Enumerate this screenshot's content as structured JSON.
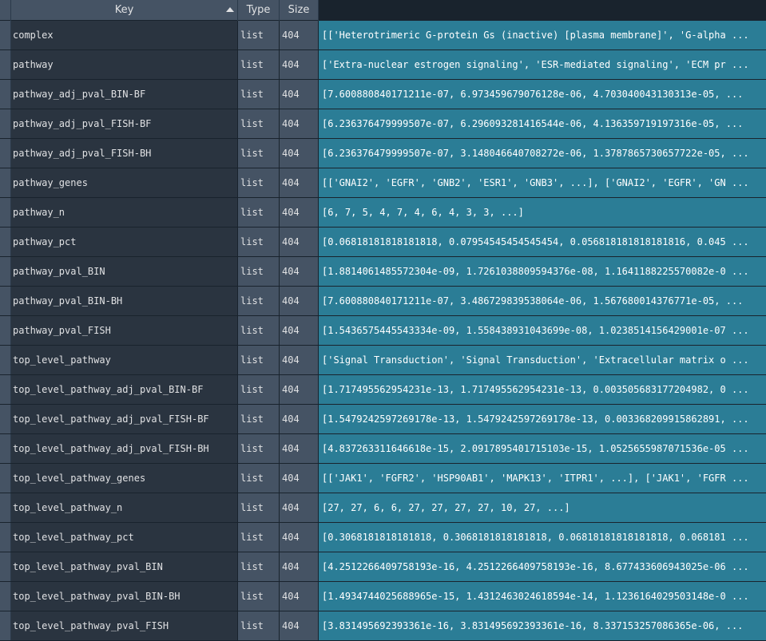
{
  "header": {
    "key": "Key",
    "type": "Type",
    "size": "Size"
  },
  "rows": [
    {
      "key": "complex",
      "type": "list",
      "size": "404",
      "value": "[['Heterotrimeric G-protein Gs (inactive) [plasma membrane]', 'G-alpha ..."
    },
    {
      "key": "pathway",
      "type": "list",
      "size": "404",
      "value": "['Extra-nuclear estrogen signaling', 'ESR-mediated signaling', 'ECM pr ..."
    },
    {
      "key": "pathway_adj_pval_BIN-BF",
      "type": "list",
      "size": "404",
      "value": "[7.600880840171211e-07, 6.973459679076128e-06, 4.703040043130313e-05, ..."
    },
    {
      "key": "pathway_adj_pval_FISH-BF",
      "type": "list",
      "size": "404",
      "value": "[6.236376479999507e-07, 6.296093281416544e-06, 4.136359719197316e-05, ..."
    },
    {
      "key": "pathway_adj_pval_FISH-BH",
      "type": "list",
      "size": "404",
      "value": "[6.236376479999507e-07, 3.148046640708272e-06, 1.3787865730657722e-05, ..."
    },
    {
      "key": "pathway_genes",
      "type": "list",
      "size": "404",
      "value": "[['GNAI2', 'EGFR', 'GNB2', 'ESR1', 'GNB3', ...], ['GNAI2', 'EGFR', 'GN ..."
    },
    {
      "key": "pathway_n",
      "type": "list",
      "size": "404",
      "value": "[6, 7, 5, 4, 7, 4, 6, 4, 3, 3, ...]"
    },
    {
      "key": "pathway_pct",
      "type": "list",
      "size": "404",
      "value": "[0.06818181818181818, 0.07954545454545454, 0.056818181818181816, 0.045 ..."
    },
    {
      "key": "pathway_pval_BIN",
      "type": "list",
      "size": "404",
      "value": "[1.8814061485572304e-09, 1.7261038809594376e-08, 1.1641188225570082e-0 ..."
    },
    {
      "key": "pathway_pval_BIN-BH",
      "type": "list",
      "size": "404",
      "value": "[7.600880840171211e-07, 3.486729839538064e-06, 1.567680014376771e-05, ..."
    },
    {
      "key": "pathway_pval_FISH",
      "type": "list",
      "size": "404",
      "value": "[1.5436575445543334e-09, 1.558438931043699e-08, 1.0238514156429001e-07 ..."
    },
    {
      "key": "top_level_pathway",
      "type": "list",
      "size": "404",
      "value": "['Signal Transduction', 'Signal Transduction', 'Extracellular matrix o ..."
    },
    {
      "key": "top_level_pathway_adj_pval_BIN-BF",
      "type": "list",
      "size": "404",
      "value": "[1.717495562954231e-13, 1.717495562954231e-13, 0.003505683177204982, 0 ..."
    },
    {
      "key": "top_level_pathway_adj_pval_FISH-BF",
      "type": "list",
      "size": "404",
      "value": "[1.5479242597269178e-13, 1.5479242597269178e-13, 0.003368209915862891, ..."
    },
    {
      "key": "top_level_pathway_adj_pval_FISH-BH",
      "type": "list",
      "size": "404",
      "value": "[4.837263311646618e-15, 2.0917895401715103e-15, 1.0525655987071536e-05 ..."
    },
    {
      "key": "top_level_pathway_genes",
      "type": "list",
      "size": "404",
      "value": "[['JAK1', 'FGFR2', 'HSP90AB1', 'MAPK13', 'ITPR1', ...], ['JAK1', 'FGFR ..."
    },
    {
      "key": "top_level_pathway_n",
      "type": "list",
      "size": "404",
      "value": "[27, 27, 6, 6, 27, 27, 27, 27, 10, 27, ...]"
    },
    {
      "key": "top_level_pathway_pct",
      "type": "list",
      "size": "404",
      "value": "[0.3068181818181818, 0.3068181818181818, 0.06818181818181818, 0.068181 ..."
    },
    {
      "key": "top_level_pathway_pval_BIN",
      "type": "list",
      "size": "404",
      "value": "[4.2512266409758193e-16, 4.2512266409758193e-16, 8.677433606943025e-06 ..."
    },
    {
      "key": "top_level_pathway_pval_BIN-BH",
      "type": "list",
      "size": "404",
      "value": "[1.4934744025688965e-15, 1.4312463024618594e-14, 1.1236164029503148e-0 ..."
    },
    {
      "key": "top_level_pathway_pval_FISH",
      "type": "list",
      "size": "404",
      "value": "[3.831495692393361e-16, 3.831495692393361e-16, 8.337153257086365e-06, ..."
    }
  ]
}
